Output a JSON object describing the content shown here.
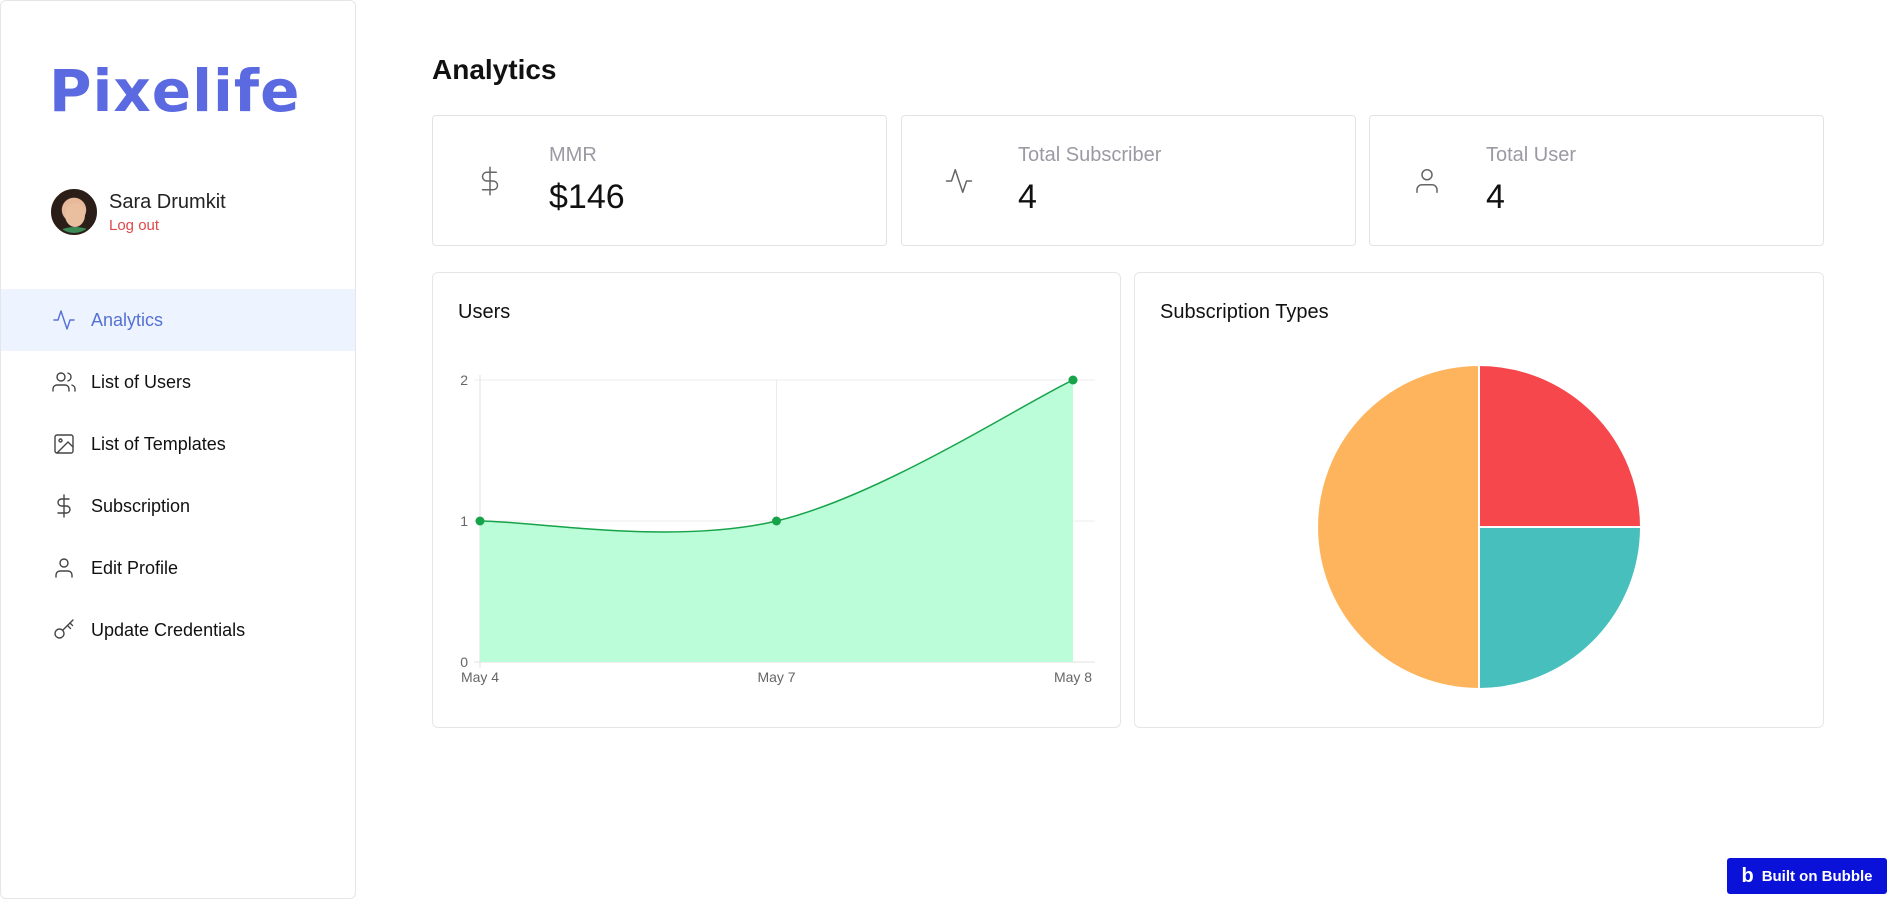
{
  "brand": {
    "name": "Pixelife",
    "color": "#5b6ae0"
  },
  "user": {
    "name": "Sara Drumkit",
    "logout_label": "Log out"
  },
  "nav": {
    "items": [
      {
        "label": "Analytics",
        "icon": "activity-icon",
        "active": true
      },
      {
        "label": "List of Users",
        "icon": "users-icon"
      },
      {
        "label": "List of Templates",
        "icon": "image-icon"
      },
      {
        "label": "Subscription",
        "icon": "dollar-icon"
      },
      {
        "label": "Edit Profile",
        "icon": "user-icon"
      },
      {
        "label": "Update Credentials",
        "icon": "key-icon"
      }
    ]
  },
  "page": {
    "title": "Analytics"
  },
  "stats": [
    {
      "label": "MMR",
      "value": "$146",
      "icon": "dollar-icon"
    },
    {
      "label": "Total Subscriber",
      "value": "4",
      "icon": "activity-icon"
    },
    {
      "label": "Total User",
      "value": "4",
      "icon": "user-icon"
    }
  ],
  "chart_data": [
    {
      "type": "area",
      "title": "Users",
      "categories": [
        "May 4",
        "May 7",
        "May 8"
      ],
      "series": [
        {
          "values": [
            1,
            1,
            2
          ],
          "color": "#16a34a",
          "fill": "#bbfdd8"
        }
      ],
      "ylim": [
        0,
        2
      ],
      "yticks": [
        0,
        1,
        2
      ],
      "grid": true,
      "xlabel": "",
      "ylabel": ""
    },
    {
      "type": "pie",
      "title": "Subscription Types",
      "slices": [
        {
          "value": 25,
          "color": "#f5474c"
        },
        {
          "value": 25,
          "color": "#46bfbd"
        },
        {
          "value": 50,
          "color": "#fdb45c"
        }
      ]
    }
  ],
  "badge": {
    "label": "Built on Bubble",
    "color": "#0a12d9"
  }
}
